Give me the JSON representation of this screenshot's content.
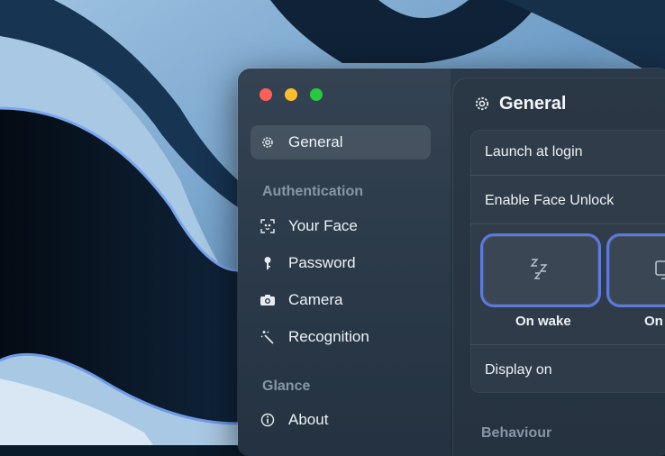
{
  "sidebar": {
    "items_main": [
      {
        "label": "General",
        "icon": "gear-icon",
        "selected": true
      }
    ],
    "sections": [
      {
        "title": "Authentication",
        "items": [
          {
            "label": "Your Face",
            "icon": "face-scan-icon"
          },
          {
            "label": "Password",
            "icon": "key-icon"
          },
          {
            "label": "Camera",
            "icon": "camera-icon"
          },
          {
            "label": "Recognition",
            "icon": "magic-wand-icon"
          }
        ]
      },
      {
        "title": "Glance",
        "items": [
          {
            "label": "About",
            "icon": "info-icon"
          }
        ]
      }
    ]
  },
  "page": {
    "title": "General",
    "title_icon": "gear-icon",
    "settings": {
      "launch_at_login": "Launch at login",
      "enable_face_unlock": "Enable Face Unlock",
      "choices": [
        {
          "label": "On wake",
          "icon": "sleep-zzz-icon"
        },
        {
          "label": "On",
          "icon": "display-icon"
        }
      ],
      "display_on": "Display on"
    },
    "behaviour_section": "Behaviour"
  },
  "colors": {
    "accent": "#5b7be0",
    "close": "#fe5f57",
    "minimize": "#febc2e",
    "zoom": "#28c840"
  }
}
